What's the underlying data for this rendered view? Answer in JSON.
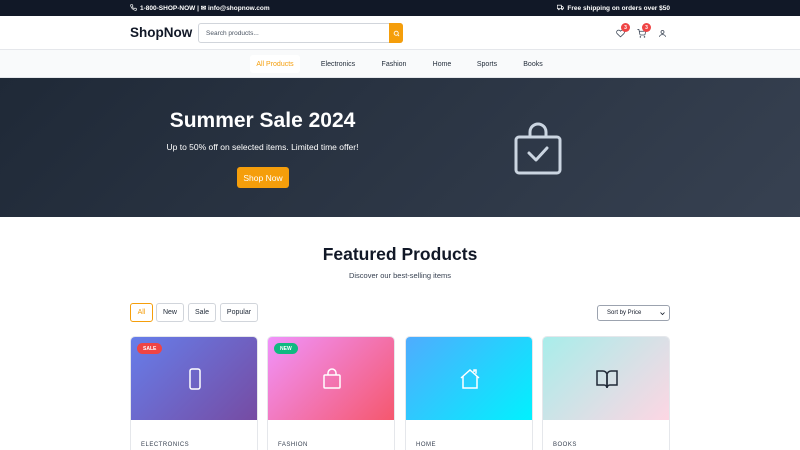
{
  "topbar": {
    "contact": "1-800-SHOP-NOW | ✉ info@shopnow.com",
    "shipping": "Free shipping on orders over $50",
    "icons": [
      "phone-icon",
      "truck-icon"
    ]
  },
  "header": {
    "logo": "ShopNow",
    "search_placeholder": "Search products...",
    "wishlist_count": "3",
    "cart_count": "3",
    "icons": [
      "search-icon",
      "heart-icon",
      "cart-icon",
      "user-icon"
    ]
  },
  "categories": [
    {
      "label": "All Products",
      "active": true
    },
    {
      "label": "Electronics",
      "active": false
    },
    {
      "label": "Fashion",
      "active": false
    },
    {
      "label": "Home",
      "active": false
    },
    {
      "label": "Sports",
      "active": false
    },
    {
      "label": "Books",
      "active": false
    }
  ],
  "hero": {
    "title": "Summer Sale 2024",
    "subtitle": "Up to 50% off on selected items. Limited time offer!",
    "cta": "Shop Now",
    "icon": "shopping-bag-check-icon"
  },
  "featured": {
    "title": "Featured Products",
    "subtitle": "Discover our best-selling items",
    "filters": [
      {
        "label": "All",
        "active": true
      },
      {
        "label": "New",
        "active": false
      },
      {
        "label": "Sale",
        "active": false
      },
      {
        "label": "Popular",
        "active": false
      }
    ],
    "sort_label": "Sort by Price"
  },
  "products": [
    {
      "category": "ELECTRONICS",
      "badge": "SALE",
      "badge_color": "#ef4444",
      "icon": "smartphone-icon"
    },
    {
      "category": "FASHION",
      "badge": "NEW",
      "badge_color": "#10b981",
      "icon": "shopping-bag-icon"
    },
    {
      "category": "HOME",
      "badge": "",
      "icon": "house-icon"
    },
    {
      "category": "BOOKS",
      "badge": "",
      "icon": "book-open-icon"
    }
  ],
  "colors": {
    "accent": "#f59e0b",
    "dark": "#111827",
    "hero_from": "#1f2937",
    "hero_to": "#374151"
  }
}
